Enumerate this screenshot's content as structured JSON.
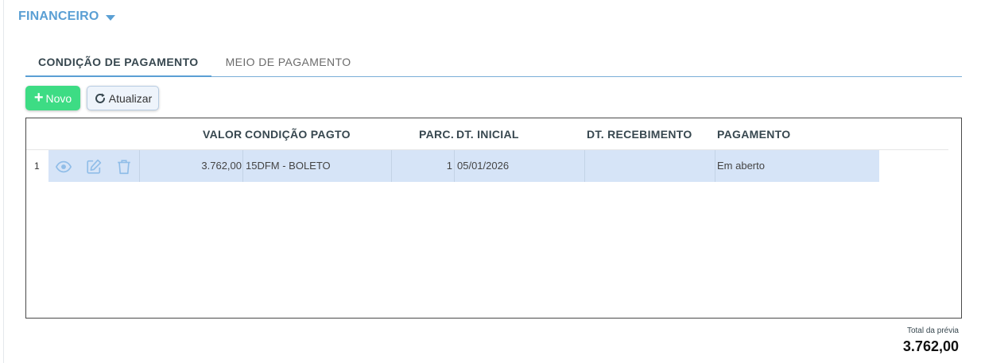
{
  "section": {
    "title": "FINANCEIRO"
  },
  "tabs": [
    {
      "label": "CONDIÇÃO DE PAGAMENTO",
      "active": true
    },
    {
      "label": "MEIO DE PAGAMENTO",
      "active": false
    }
  ],
  "toolbar": {
    "new_label": "Novo",
    "refresh_label": "Atualizar"
  },
  "grid": {
    "columns": {
      "valor": "VALOR",
      "condicao": "CONDIÇÃO PAGTO",
      "parc": "PARC.",
      "dt_inicial": "DT. INICIAL",
      "dt_recebimento": "DT. RECEBIMENTO",
      "pagamento": "PAGAMENTO"
    },
    "rows": [
      {
        "index": "1",
        "valor": "3.762,00",
        "condicao": "15DFM - BOLETO",
        "parc": "1",
        "dt_inicial": "05/01/2026",
        "dt_recebimento": "",
        "pagamento": "Em aberto"
      }
    ]
  },
  "footer": {
    "total_label": "Total da prévia",
    "total_value": "3.762,00"
  },
  "colors": {
    "accent": "#5a9fd4",
    "new_button": "#3ddc84",
    "row_selected": "#d6e4f7",
    "icon": "#90bde8"
  }
}
